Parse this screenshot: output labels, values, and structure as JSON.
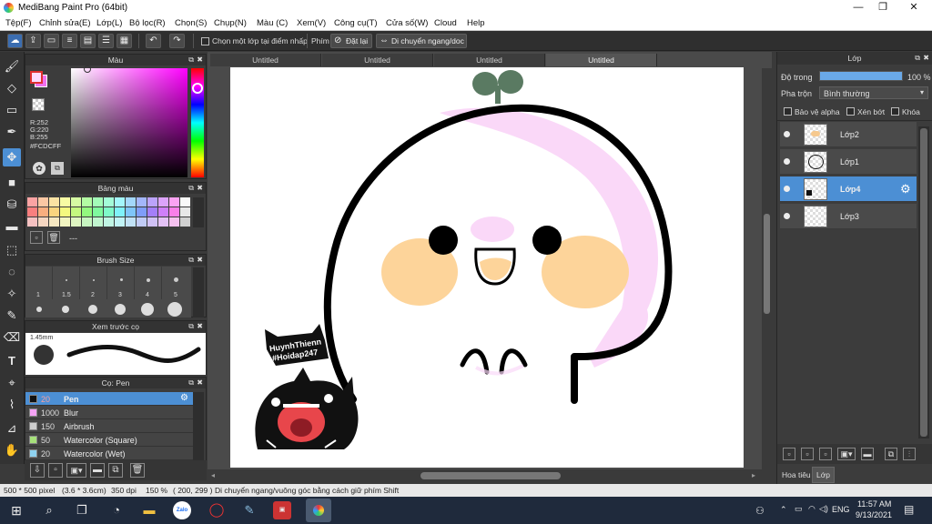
{
  "window": {
    "title": "MediBang Paint Pro (64bit)",
    "min": "—",
    "max": "❐",
    "close": "✕"
  },
  "menu": [
    "Tệp(F)",
    "Chỉnh sửa(E)",
    "Lớp(L)",
    "Bộ lọc(R)",
    "Chọn(S)",
    "Chụp(N)",
    "Màu (C)",
    "Xem(V)",
    "Công cụ(T)",
    "Cửa số(W)",
    "Cloud",
    "Help"
  ],
  "toolbar": {
    "select_layer_label": "Chọn một lớp tại điểm nhấp",
    "key_label": "Phím",
    "reset_label": "Đặt lại",
    "move_label": "Di chuyển ngang/doc"
  },
  "color_panel": {
    "title": "Màu",
    "r": "R:252",
    "g": "G:220",
    "b": "B:255",
    "hex": "#FCDCFF",
    "primary_color": "#FCDCFF",
    "secondary_color": "#f070f0",
    "accent": "#4c8fd4"
  },
  "palette_panel": {
    "title": "Bảng màu",
    "dash": "---",
    "swatches": [
      "#fba3a3",
      "#fbc7a3",
      "#fbe2a3",
      "#f7fba3",
      "#d6fba3",
      "#b3fba3",
      "#a3fbb8",
      "#a3fbd8",
      "#a3f6fb",
      "#a3d7fb",
      "#a3b6fb",
      "#bba3fb",
      "#dca3fb",
      "#fba3f2",
      "#f9f9f9",
      "#f97f7f",
      "#f9ae7f",
      "#f9d47f",
      "#f4f97f",
      "#c4f97f",
      "#93f97f",
      "#7ff99e",
      "#7ff9c9",
      "#7ff2f9",
      "#7fc5f9",
      "#7f9df9",
      "#a47ff9",
      "#cf7ff9",
      "#f97fe9",
      "#e8e8e8",
      "#f5c1c1",
      "#f5d6c1",
      "#f5e7c1",
      "#f2f5c1",
      "#def5c1",
      "#c8f5c1",
      "#c1f5cf",
      "#c1f5e4",
      "#c1f3f5",
      "#c1e1f5",
      "#c1cbf5",
      "#d0c1f5",
      "#e3c1f5",
      "#f5c1ef",
      "#d0d0d0"
    ]
  },
  "brush_size_panel": {
    "title": "Brush Size",
    "sizes": [
      "1",
      "1.5",
      "2",
      "3",
      "4",
      "5"
    ]
  },
  "preview_panel": {
    "title": "Xem trước cọ",
    "size": "1.45mm"
  },
  "brush_panel": {
    "title": "Cọ: Pen",
    "items": [
      {
        "size": "20",
        "name": "Pen",
        "color": "#111111",
        "selected": true
      },
      {
        "size": "1000",
        "name": "Blur",
        "color": "#f4a3f4",
        "selected": false
      },
      {
        "size": "150",
        "name": "Airbrush",
        "color": "#cccccc",
        "selected": false
      },
      {
        "size": "50",
        "name": "Watercolor (Square)",
        "color": "#a6e07a",
        "selected": false
      },
      {
        "size": "20",
        "name": "Watercolor (Wet)",
        "color": "#8fd2f0",
        "selected": false
      }
    ]
  },
  "doc_tabs": [
    "Untitled",
    "Untitled",
    "Untitled",
    "Untitled"
  ],
  "canvas": {
    "signature_line1": "HuynhThienn",
    "signature_line2": "#Hoidap247"
  },
  "layer_panel": {
    "title": "Lớp",
    "opacity_label": "Độ trong",
    "opacity_value": "100 %",
    "opacity_fraction": 1.0,
    "blend_label": "Pha trộn",
    "blend_value": "Bình thường",
    "alpha_protect": "Bảo vệ alpha",
    "clip": "Xén bớt",
    "lock": "Khóa",
    "layers": [
      {
        "name": "Lớp2",
        "selected": false
      },
      {
        "name": "Lớp1",
        "selected": false
      },
      {
        "name": "Lớp4",
        "selected": true
      },
      {
        "name": "Lớp3",
        "selected": false
      }
    ],
    "tab_navigator": "Hoa tiêu",
    "tab_layer": "Lớp"
  },
  "status": {
    "size": "500 * 500 pixel",
    "physical": "(3.6 * 3.6cm)",
    "dpi": "350 dpi",
    "zoom": "150 %",
    "cursor": "( 200, 299 )",
    "hint": "Di chuyển ngang/vuông góc bằng cách giữ phím Shift"
  },
  "taskbar": {
    "lang": "ENG",
    "time": "11:57 AM",
    "date": "9/13/2021",
    "zalo": "Zalo"
  }
}
